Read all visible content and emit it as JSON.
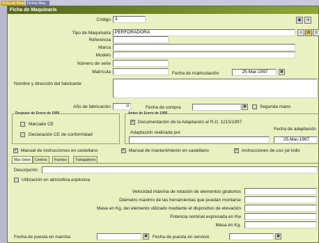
{
  "taskbar": {
    "items": [
      "Ficha de Maquinaria",
      "Fichas Maq."
    ]
  },
  "window": {
    "title": "Ficha de Maquinaria"
  },
  "fields": {
    "codigo": {
      "label": "Código",
      "value": "3"
    },
    "tipo": {
      "label": "Tipo de Maquinaria",
      "value": "PERFORADORA"
    },
    "referencia": {
      "label": "Referencia",
      "value": ""
    },
    "marca": {
      "label": "Marca",
      "value": ""
    },
    "modelo": {
      "label": "Modelo",
      "value": ""
    },
    "serie": {
      "label": "Número de serie",
      "value": ""
    },
    "matricula": {
      "label": "Matrícula",
      "value": ""
    },
    "fecha_matriculacion": {
      "label": "Fecha de matriculación",
      "value": "25-Mar-1997"
    },
    "fabricante": {
      "label": "Nombre y dirección del fabricante",
      "value": ""
    },
    "anio_fabricacion": {
      "label": "Año de fabricación",
      "value": "0"
    },
    "fecha_compra": {
      "label": "Fecha de compra",
      "value": ""
    },
    "segunda_mano": {
      "label": "Segunda mano",
      "checked": false
    }
  },
  "groups": {
    "despues": {
      "title": "Después de Enero de 1995",
      "marcado": {
        "label": "Marcado CE",
        "checked": false
      },
      "declaracion": {
        "label": "Declaración CE de conformidad",
        "checked": false
      }
    },
    "antes": {
      "title": "Antes de Enero de 1995",
      "documentacion": {
        "label": "Documentación de la Adaptación al R.D. 1215/1997",
        "checked": true
      },
      "adaptacion_label": "Adaptación realizada por",
      "adaptacion_value": "",
      "fecha_label": "Fecha de adaptación",
      "fecha_value": "25-Mar-1997"
    }
  },
  "manuals": {
    "castellano": {
      "label": "Manual de instrucciones en castellano",
      "checked": true
    },
    "mantenimiento": {
      "label": "Manual de mantenimiento en castellano",
      "checked": true
    },
    "uso": {
      "label": "Instrucciones de uso (al indic",
      "checked": true
    }
  },
  "tabs": [
    "Más Datos",
    "Centros",
    "Puestos",
    "Trabajadores"
  ],
  "more": {
    "descripcion": {
      "label": "Descripción",
      "value": ""
    },
    "atmosfera": {
      "label": "Utilización en atmósfera explosiva",
      "checked": false
    },
    "velocidad": {
      "label": "Velocidad máxima de rotación de elementos giratorios",
      "value": ""
    },
    "diametro": {
      "label": "Diámetro máximo de las herramientas que puedan montarse",
      "value": ""
    },
    "masa_disp": {
      "label": "Masa en Kg. del elemento utilizado mediante el dispositivo de elevación",
      "value": ""
    },
    "potencia": {
      "label": "Potencia nominal expresada en Kw",
      "value": ""
    },
    "masa": {
      "label": "Masa en Kg.",
      "value": ""
    },
    "puesta_marcha": {
      "label": "Fecha de puesta en marcha",
      "value": ""
    },
    "puesta_servicio": {
      "label": "Fecha de puesta en servicio",
      "value": ""
    }
  },
  "colors": {
    "titlebar": "#52681a",
    "form_bg": "#e8f1bf",
    "desktop": "#b8b8ce"
  },
  "icons": {
    "calendar": "calendar-icon",
    "dropdown": "dropdown-arrow-icon"
  }
}
